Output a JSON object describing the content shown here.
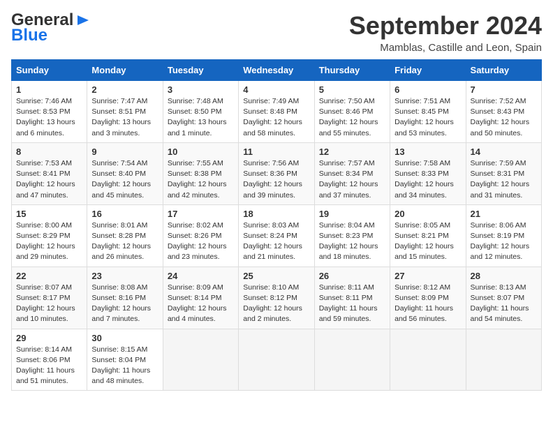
{
  "header": {
    "logo_line1": "General",
    "logo_line2": "Blue",
    "month_title": "September 2024",
    "location": "Mamblas, Castille and Leon, Spain"
  },
  "days_of_week": [
    "Sunday",
    "Monday",
    "Tuesday",
    "Wednesday",
    "Thursday",
    "Friday",
    "Saturday"
  ],
  "weeks": [
    [
      {
        "day": "1",
        "sunrise": "Sunrise: 7:46 AM",
        "sunset": "Sunset: 8:53 PM",
        "daylight": "Daylight: 13 hours and 6 minutes."
      },
      {
        "day": "2",
        "sunrise": "Sunrise: 7:47 AM",
        "sunset": "Sunset: 8:51 PM",
        "daylight": "Daylight: 13 hours and 3 minutes."
      },
      {
        "day": "3",
        "sunrise": "Sunrise: 7:48 AM",
        "sunset": "Sunset: 8:50 PM",
        "daylight": "Daylight: 13 hours and 1 minute."
      },
      {
        "day": "4",
        "sunrise": "Sunrise: 7:49 AM",
        "sunset": "Sunset: 8:48 PM",
        "daylight": "Daylight: 12 hours and 58 minutes."
      },
      {
        "day": "5",
        "sunrise": "Sunrise: 7:50 AM",
        "sunset": "Sunset: 8:46 PM",
        "daylight": "Daylight: 12 hours and 55 minutes."
      },
      {
        "day": "6",
        "sunrise": "Sunrise: 7:51 AM",
        "sunset": "Sunset: 8:45 PM",
        "daylight": "Daylight: 12 hours and 53 minutes."
      },
      {
        "day": "7",
        "sunrise": "Sunrise: 7:52 AM",
        "sunset": "Sunset: 8:43 PM",
        "daylight": "Daylight: 12 hours and 50 minutes."
      }
    ],
    [
      {
        "day": "8",
        "sunrise": "Sunrise: 7:53 AM",
        "sunset": "Sunset: 8:41 PM",
        "daylight": "Daylight: 12 hours and 47 minutes."
      },
      {
        "day": "9",
        "sunrise": "Sunrise: 7:54 AM",
        "sunset": "Sunset: 8:40 PM",
        "daylight": "Daylight: 12 hours and 45 minutes."
      },
      {
        "day": "10",
        "sunrise": "Sunrise: 7:55 AM",
        "sunset": "Sunset: 8:38 PM",
        "daylight": "Daylight: 12 hours and 42 minutes."
      },
      {
        "day": "11",
        "sunrise": "Sunrise: 7:56 AM",
        "sunset": "Sunset: 8:36 PM",
        "daylight": "Daylight: 12 hours and 39 minutes."
      },
      {
        "day": "12",
        "sunrise": "Sunrise: 7:57 AM",
        "sunset": "Sunset: 8:34 PM",
        "daylight": "Daylight: 12 hours and 37 minutes."
      },
      {
        "day": "13",
        "sunrise": "Sunrise: 7:58 AM",
        "sunset": "Sunset: 8:33 PM",
        "daylight": "Daylight: 12 hours and 34 minutes."
      },
      {
        "day": "14",
        "sunrise": "Sunrise: 7:59 AM",
        "sunset": "Sunset: 8:31 PM",
        "daylight": "Daylight: 12 hours and 31 minutes."
      }
    ],
    [
      {
        "day": "15",
        "sunrise": "Sunrise: 8:00 AM",
        "sunset": "Sunset: 8:29 PM",
        "daylight": "Daylight: 12 hours and 29 minutes."
      },
      {
        "day": "16",
        "sunrise": "Sunrise: 8:01 AM",
        "sunset": "Sunset: 8:28 PM",
        "daylight": "Daylight: 12 hours and 26 minutes."
      },
      {
        "day": "17",
        "sunrise": "Sunrise: 8:02 AM",
        "sunset": "Sunset: 8:26 PM",
        "daylight": "Daylight: 12 hours and 23 minutes."
      },
      {
        "day": "18",
        "sunrise": "Sunrise: 8:03 AM",
        "sunset": "Sunset: 8:24 PM",
        "daylight": "Daylight: 12 hours and 21 minutes."
      },
      {
        "day": "19",
        "sunrise": "Sunrise: 8:04 AM",
        "sunset": "Sunset: 8:23 PM",
        "daylight": "Daylight: 12 hours and 18 minutes."
      },
      {
        "day": "20",
        "sunrise": "Sunrise: 8:05 AM",
        "sunset": "Sunset: 8:21 PM",
        "daylight": "Daylight: 12 hours and 15 minutes."
      },
      {
        "day": "21",
        "sunrise": "Sunrise: 8:06 AM",
        "sunset": "Sunset: 8:19 PM",
        "daylight": "Daylight: 12 hours and 12 minutes."
      }
    ],
    [
      {
        "day": "22",
        "sunrise": "Sunrise: 8:07 AM",
        "sunset": "Sunset: 8:17 PM",
        "daylight": "Daylight: 12 hours and 10 minutes."
      },
      {
        "day": "23",
        "sunrise": "Sunrise: 8:08 AM",
        "sunset": "Sunset: 8:16 PM",
        "daylight": "Daylight: 12 hours and 7 minutes."
      },
      {
        "day": "24",
        "sunrise": "Sunrise: 8:09 AM",
        "sunset": "Sunset: 8:14 PM",
        "daylight": "Daylight: 12 hours and 4 minutes."
      },
      {
        "day": "25",
        "sunrise": "Sunrise: 8:10 AM",
        "sunset": "Sunset: 8:12 PM",
        "daylight": "Daylight: 12 hours and 2 minutes."
      },
      {
        "day": "26",
        "sunrise": "Sunrise: 8:11 AM",
        "sunset": "Sunset: 8:11 PM",
        "daylight": "Daylight: 11 hours and 59 minutes."
      },
      {
        "day": "27",
        "sunrise": "Sunrise: 8:12 AM",
        "sunset": "Sunset: 8:09 PM",
        "daylight": "Daylight: 11 hours and 56 minutes."
      },
      {
        "day": "28",
        "sunrise": "Sunrise: 8:13 AM",
        "sunset": "Sunset: 8:07 PM",
        "daylight": "Daylight: 11 hours and 54 minutes."
      }
    ],
    [
      {
        "day": "29",
        "sunrise": "Sunrise: 8:14 AM",
        "sunset": "Sunset: 8:06 PM",
        "daylight": "Daylight: 11 hours and 51 minutes."
      },
      {
        "day": "30",
        "sunrise": "Sunrise: 8:15 AM",
        "sunset": "Sunset: 8:04 PM",
        "daylight": "Daylight: 11 hours and 48 minutes."
      },
      {
        "day": "",
        "sunrise": "",
        "sunset": "",
        "daylight": ""
      },
      {
        "day": "",
        "sunrise": "",
        "sunset": "",
        "daylight": ""
      },
      {
        "day": "",
        "sunrise": "",
        "sunset": "",
        "daylight": ""
      },
      {
        "day": "",
        "sunrise": "",
        "sunset": "",
        "daylight": ""
      },
      {
        "day": "",
        "sunrise": "",
        "sunset": "",
        "daylight": ""
      }
    ]
  ]
}
